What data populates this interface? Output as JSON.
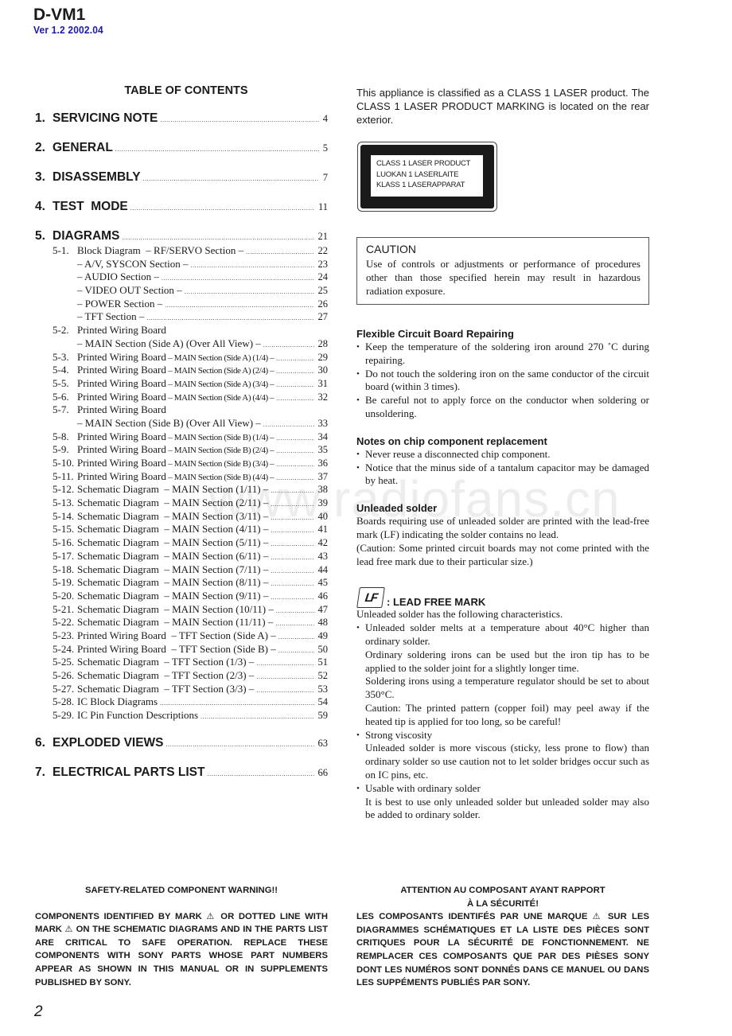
{
  "header": {
    "model": "D-VM1",
    "version": "Ver 1.2  2002.04",
    "version_color": "#1a1aa8"
  },
  "toc": {
    "title": "TABLE OF CONTENTS",
    "sections": [
      {
        "num": "1.",
        "title": "SERVICING NOTE",
        "page": "4"
      },
      {
        "num": "2.",
        "title": "GENERAL",
        "page": "5"
      },
      {
        "num": "3.",
        "title": "DISASSEMBLY",
        "page": "7"
      },
      {
        "num": "4.",
        "title": "TEST  MODE",
        "page": "11"
      },
      {
        "num": "5.",
        "title": "DIAGRAMS",
        "page": "21"
      },
      {
        "num": "6.",
        "title": "EXPLODED VIEWS",
        "page": "63"
      },
      {
        "num": "7.",
        "title": "ELECTRICAL PARTS LIST",
        "page": "66"
      }
    ],
    "diagrams": [
      {
        "num": "5-1.",
        "title": "Block Diagram  – RF/SERVO Section –",
        "small": "",
        "page": "22"
      },
      {
        "num": "",
        "title": "– A/V, SYSCON Section –",
        "small": "",
        "page": "23"
      },
      {
        "num": "",
        "title": "– AUDIO Section –",
        "small": "",
        "page": "24"
      },
      {
        "num": "",
        "title": "– VIDEO OUT Section –",
        "small": "",
        "page": "25"
      },
      {
        "num": "",
        "title": "– POWER Section –",
        "small": "",
        "page": "26"
      },
      {
        "num": "",
        "title": "– TFT Section –",
        "small": "",
        "page": "27"
      },
      {
        "num": "5-2.",
        "title": "Printed Wiring Board",
        "small": "",
        "page": ""
      },
      {
        "num": "",
        "title": "– MAIN Section (Side A) (Over All View) –",
        "small": "",
        "page": "28"
      },
      {
        "num": "5-3.",
        "title": "Printed Wiring Board",
        "small": " – MAIN Section (Side A) (1/4) –",
        "page": "29"
      },
      {
        "num": "5-4.",
        "title": "Printed Wiring Board",
        "small": " – MAIN Section (Side A) (2/4) –",
        "page": "30"
      },
      {
        "num": "5-5.",
        "title": "Printed Wiring Board",
        "small": " – MAIN Section (Side A) (3/4) –",
        "page": "31"
      },
      {
        "num": "5-6.",
        "title": "Printed Wiring Board",
        "small": " – MAIN Section (Side A) (4/4) –",
        "page": "32"
      },
      {
        "num": "5-7.",
        "title": "Printed Wiring Board",
        "small": "",
        "page": ""
      },
      {
        "num": "",
        "title": "– MAIN Section (Side B) (Over All View) –",
        "small": "",
        "page": "33"
      },
      {
        "num": "5-8.",
        "title": "Printed Wiring Board",
        "small": " – MAIN Section (Side B) (1/4) –",
        "page": "34"
      },
      {
        "num": "5-9.",
        "title": "Printed Wiring Board",
        "small": " – MAIN Section (Side B) (2/4) –",
        "page": "35"
      },
      {
        "num": "5-10.",
        "title": "Printed Wiring Board",
        "small": " – MAIN Section (Side B) (3/4) –",
        "page": "36"
      },
      {
        "num": "5-11.",
        "title": "Printed Wiring Board",
        "small": " – MAIN Section (Side B) (4/4) –",
        "page": "37"
      },
      {
        "num": "5-12.",
        "title": "Schematic Diagram  – MAIN Section (1/11) –",
        "small": "",
        "page": "38"
      },
      {
        "num": "5-13.",
        "title": "Schematic Diagram  – MAIN Section (2/11) –",
        "small": "",
        "page": "39"
      },
      {
        "num": "5-14.",
        "title": "Schematic Diagram  – MAIN Section (3/11) –",
        "small": "",
        "page": "40"
      },
      {
        "num": "5-15.",
        "title": "Schematic Diagram  – MAIN Section (4/11) –",
        "small": "",
        "page": "41"
      },
      {
        "num": "5-16.",
        "title": "Schematic Diagram  – MAIN Section (5/11) –",
        "small": "",
        "page": "42"
      },
      {
        "num": "5-17.",
        "title": "Schematic Diagram  – MAIN Section (6/11) –",
        "small": "",
        "page": "43"
      },
      {
        "num": "5-18.",
        "title": "Schematic Diagram  – MAIN Section (7/11) –",
        "small": "",
        "page": "44"
      },
      {
        "num": "5-19.",
        "title": "Schematic Diagram  – MAIN Section (8/11) –",
        "small": "",
        "page": "45"
      },
      {
        "num": "5-20.",
        "title": "Schematic Diagram  – MAIN Section (9/11) –",
        "small": "",
        "page": "46"
      },
      {
        "num": "5-21.",
        "title": "Schematic Diagram  – MAIN Section (10/11) –",
        "small": "",
        "page": "47"
      },
      {
        "num": "5-22.",
        "title": "Schematic Diagram  – MAIN Section (11/11) –",
        "small": "",
        "page": "48"
      },
      {
        "num": "5-23.",
        "title": "Printed Wiring Board  – TFT Section (Side A) –",
        "small": "",
        "page": "49"
      },
      {
        "num": "5-24.",
        "title": "Printed Wiring Board  – TFT Section (Side B) –",
        "small": "",
        "page": "50"
      },
      {
        "num": "5-25.",
        "title": "Schematic Diagram  – TFT Section (1/3) –",
        "small": "",
        "page": "51"
      },
      {
        "num": "5-26.",
        "title": "Schematic Diagram  – TFT Section (2/3) –",
        "small": "",
        "page": "52"
      },
      {
        "num": "5-27.",
        "title": "Schematic Diagram  – TFT Section (3/3) –",
        "small": "",
        "page": "53"
      },
      {
        "num": "5-28.",
        "title": "IC Block Diagrams",
        "small": "",
        "page": "54"
      },
      {
        "num": "5-29.",
        "title": "IC Pin Function Descriptions",
        "small": "",
        "page": "59"
      }
    ]
  },
  "laser": {
    "intro": "This appliance is classified as a CLASS 1 LASER product. The CLASS 1 LASER PRODUCT MARKING is located on the rear exterior.",
    "label_lines": [
      "CLASS 1 LASER PRODUCT",
      "LUOKAN 1 LASERLAITE",
      "KLASS 1 LASERAPPARAT"
    ]
  },
  "caution": {
    "title": "CAUTION",
    "text": "Use of controls or adjustments or performance of procedures other than those specified herein may result in hazardous radiation exposure."
  },
  "flexible": {
    "heading": "Flexible Circuit Board Repairing",
    "bullets": [
      "Keep the temperature of the soldering iron around 270 ˚C during repairing.",
      "Do not touch the soldering iron on the same conductor of the circuit board (within 3 times).",
      "Be careful not to apply force on the conductor when soldering or unsoldering."
    ]
  },
  "chip": {
    "heading": "Notes on chip component replacement",
    "bullets": [
      "Never reuse a disconnected chip component.",
      "Notice that the minus side of a tantalum capacitor may be damaged by heat."
    ]
  },
  "unleaded": {
    "heading": "Unleaded solder",
    "para1": "Boards requiring use of unleaded solder are printed with the lead-free mark (LF) indicating the solder contains no lead.",
    "para2": "(Caution: Some printed circuit boards may not come printed with the lead free mark due to their particular size.)"
  },
  "lead_free": {
    "icon_text": "LF",
    "title": ": LEAD FREE MARK",
    "intro": "Unleaded solder has the following characteristics.",
    "bullets": [
      {
        "lead": "Unleaded solder melts at a temperature about 40°C higher than ordinary solder.",
        "subs": [
          "Ordinary soldering irons can be used but the iron tip has to be applied to the solder joint for a slightly longer time.",
          "Soldering irons using a temperature regulator should be set to about 350°C.",
          "Caution: The printed pattern (copper foil) may peel away if the heated tip is applied for too long, so be careful!"
        ]
      },
      {
        "lead": "Strong viscosity",
        "subs": [
          "Unleaded solder is more viscous (sticky, less prone to flow) than ordinary solder so use caution not to let solder bridges occur such as on IC pins, etc."
        ]
      },
      {
        "lead": "Usable with ordinary solder",
        "subs": [
          "It is best to use only unleaded solder but unleaded solder may also be added to ordinary solder."
        ]
      }
    ]
  },
  "watermark": "www.radiofans.cn",
  "warning_en": {
    "title": "SAFETY-RELATED COMPONENT WARNING!!",
    "body_parts": [
      "COMPONENTS IDENTIFIED BY MARK ",
      "⚠",
      " OR DOTTED LINE WITH MARK ",
      "⚠",
      " ON THE SCHEMATIC DIAGRAMS AND IN THE PARTS LIST ARE CRITICAL TO SAFE OPERATION. REPLACE THESE COMPONENTS WITH SONY PARTS WHOSE PART NUMBERS APPEAR AS SHOWN IN THIS MANUAL OR IN SUPPLEMENTS PUBLISHED BY SONY."
    ]
  },
  "warning_fr": {
    "title_line1": "ATTENTION AU COMPOSANT AYANT RAPPORT",
    "title_line2": "À LA SÉCURITÉ!",
    "body_parts": [
      "LES COMPOSANTS IDENTIFÉS PAR UNE MARQUE ",
      "⚠",
      " SUR LES DIAGRAMMES SCHÉMATIQUES ET LA LISTE DES PIÈCES SONT CRITIQUES POUR LA SÉCURITÉ DE FONCTIONNEMENT. NE REMPLACER CES COMPOSANTS QUE PAR DES PIÈSES SONY DONT LES NUMÉROS SONT DONNÉS DANS CE MANUEL OU DANS LES SUPPÉMENTS PUBLIÉS PAR SONY."
    ]
  },
  "page_number": "2"
}
